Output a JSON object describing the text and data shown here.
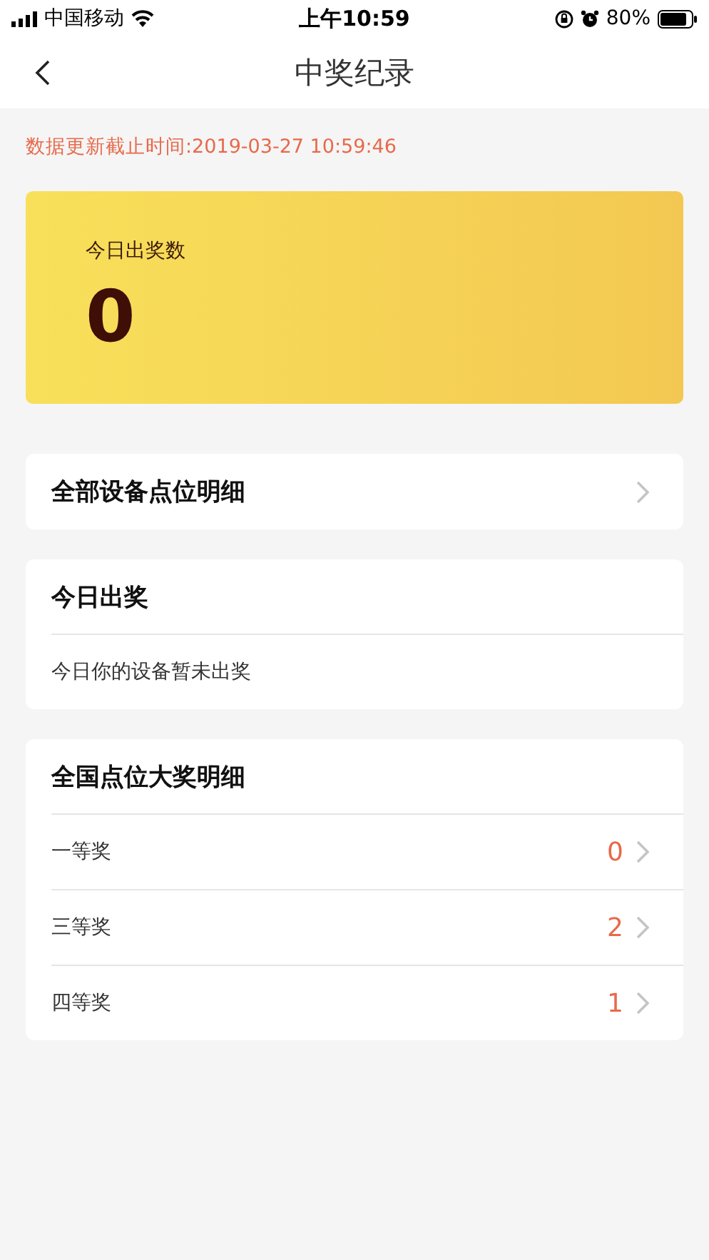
{
  "status_bar": {
    "carrier": "中国移动",
    "time": "上午10:59",
    "battery": "80%"
  },
  "nav": {
    "title": "中奖纪录"
  },
  "update_time": "数据更新截止时间:2019-03-27 10:59:46",
  "summary": {
    "label": "今日出奖数",
    "value": "0"
  },
  "all_devices": {
    "title": "全部设备点位明细"
  },
  "today": {
    "title": "今日出奖",
    "message": "今日你的设备暂未出奖"
  },
  "national": {
    "title": "全国点位大奖明细",
    "rows": [
      {
        "label": "一等奖",
        "count": "0"
      },
      {
        "label": "三等奖",
        "count": "2"
      },
      {
        "label": "四等奖",
        "count": "1"
      }
    ]
  }
}
